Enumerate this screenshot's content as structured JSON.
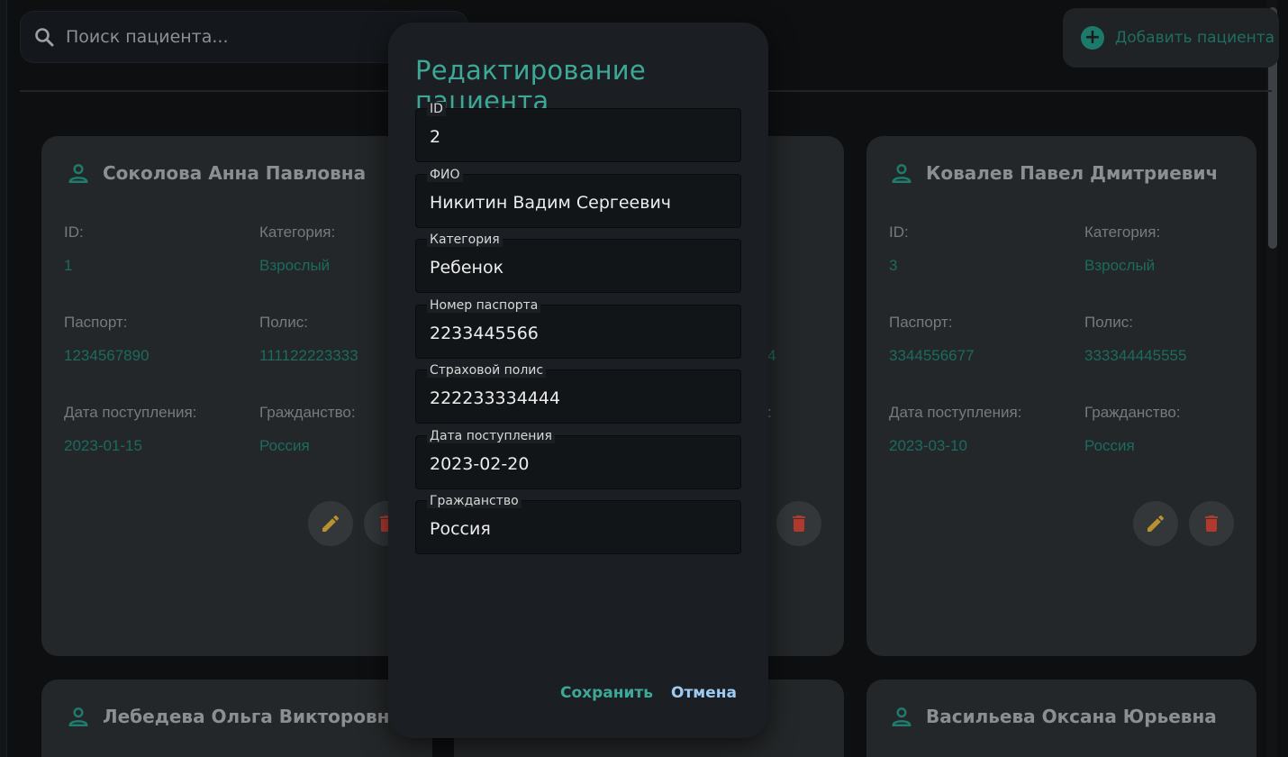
{
  "search": {
    "placeholder": "Поиск пациента..."
  },
  "header": {
    "add_label": "Добавить пациента"
  },
  "cards": [
    {
      "name": "Соколова Анна Павловна",
      "id_label": "ID:",
      "id": "1",
      "category_label": "Категория:",
      "category": "Взрослый",
      "passport_label": "Паспорт:",
      "passport": "1234567890",
      "policy_label": "Полис:",
      "policy": "111122223333",
      "date_label": "Дата поступления:",
      "date": "2023-01-15",
      "citizenship_label": "Гражданство:",
      "citizenship": "Россия"
    },
    {
      "policy_tail": "4",
      "citizenship_label_tail": ":"
    },
    {
      "name": "Ковалев Павел Дмитриевич",
      "id_label": "ID:",
      "id": "3",
      "category_label": "Категория:",
      "category": "Взрослый",
      "passport_label": "Паспорт:",
      "passport": "3344556677",
      "policy_label": "Полис:",
      "policy": "333344445555",
      "date_label": "Дата поступления:",
      "date": "2023-03-10",
      "citizenship_label": "Гражданство:",
      "citizenship": "Россия"
    },
    {
      "name": "Лебедева Ольга Викторовна"
    },
    {
      "name": "Васильева Оксана Юрьевна"
    }
  ],
  "dialog": {
    "title": "Редактирование пациента",
    "fields": [
      {
        "label": "ID",
        "value": "2"
      },
      {
        "label": "ФИО",
        "value": "Никитин Вадим Сергеевич"
      },
      {
        "label": "Категория",
        "value": "Ребенок"
      },
      {
        "label": "Номер паспорта",
        "value": "2233445566"
      },
      {
        "label": "Страховой полис",
        "value": "222233334444"
      },
      {
        "label": "Дата поступления",
        "value": "2023-02-20"
      },
      {
        "label": "Гражданство",
        "value": "Россия"
      }
    ],
    "save_label": "Сохранить",
    "cancel_label": "Отмена"
  },
  "colors": {
    "accent": "#3ea897",
    "edit": "#b8922e",
    "delete": "#b03a2e",
    "cancel": "#9ecbf2"
  },
  "icons": {
    "search": "search-icon",
    "add": "add-circle-icon",
    "person": "person-icon",
    "edit": "pencil-icon",
    "delete": "trash-icon"
  }
}
